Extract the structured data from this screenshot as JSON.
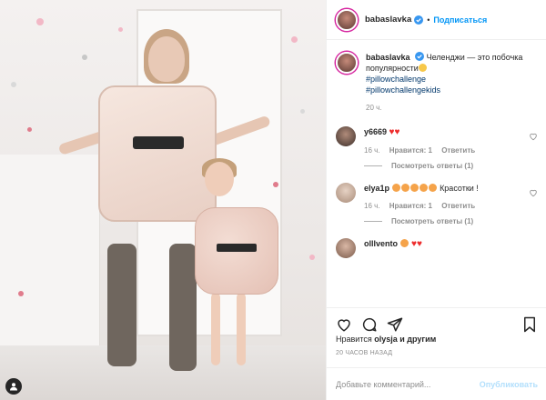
{
  "post": {
    "username": "babaslavka",
    "follow_label": "Подписаться",
    "caption": "Челенджи — это побочка популярности",
    "hashtags": [
      "#pillowchallenge",
      "#pillowchallengekids"
    ],
    "caption_time": "20 ч."
  },
  "comments": [
    {
      "username": "y6669",
      "text": "",
      "time": "16 ч.",
      "likes": "Нравится: 1",
      "reply": "Ответить",
      "view_replies": "Посмотреть ответы (1)"
    },
    {
      "username": "elya1p",
      "text": "Красотки !",
      "time": "16 ч.",
      "likes": "Нравится: 1",
      "reply": "Ответить",
      "view_replies": "Посмотреть ответы (1)"
    },
    {
      "username": "olllvento",
      "text": ""
    }
  ],
  "engagement": {
    "likes_prefix": "Нравится",
    "likes_user": "olysja",
    "likes_suffix": "и другим",
    "timestamp": "20 ЧАСОВ НАЗАД"
  },
  "composer": {
    "placeholder": "Добавьте комментарий...",
    "post_label": "Опубликовать"
  },
  "colors": {
    "link": "#00376b",
    "follow": "#0095f6",
    "post_disabled": "#b2dffc",
    "heart": "#ed2b2b"
  }
}
